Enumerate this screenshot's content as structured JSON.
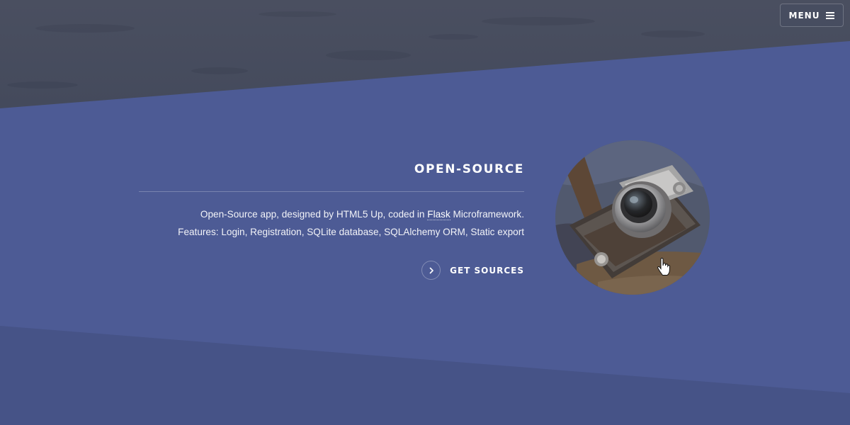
{
  "header": {
    "menu_label": "MENU",
    "menu_icon": "hamburger-icon"
  },
  "section": {
    "title": "OPEN-SOURCE",
    "description_line1_before": "Open-Source app, designed by HTML5 Up, coded in ",
    "description_link": "Flask",
    "description_line1_after": " Microframework.",
    "description_line2": "Features: Login, Registration, SQLite database, SQLAlchemy ORM, Static export",
    "cta_label": "GET SOURCES",
    "cta_icon": "chevron-right-icon",
    "image_subject": "camera-photo"
  },
  "colors": {
    "accent": "#4d5b95",
    "top_band": "#4a4f62",
    "bottom_band": "#475488"
  }
}
